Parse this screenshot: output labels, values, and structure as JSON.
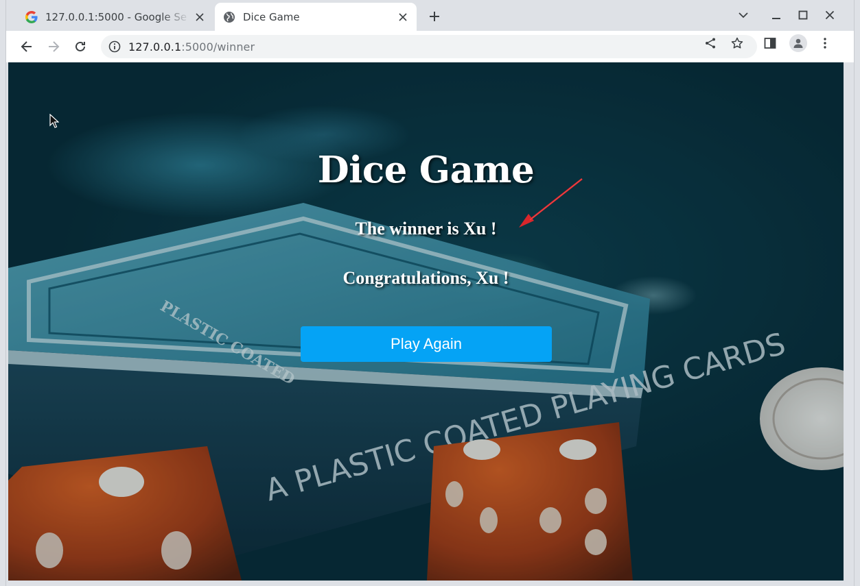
{
  "browser": {
    "tabs": [
      {
        "title": "127.0.0.1:5000 - Google Se",
        "favicon": "google-icon",
        "active": false
      },
      {
        "title": "Dice Game",
        "favicon": "globe-icon",
        "active": true
      }
    ],
    "address": {
      "host": "127.0.0.1",
      "path": ":5000/winner"
    }
  },
  "page": {
    "title": "Dice Game",
    "winner_text": "The winner is Xu !",
    "congrats_text": "Congratulations, Xu !",
    "play_again_label": "Play Again",
    "accent_color": "#05a3f5",
    "background_scene": "playing cards, dice and poker chips",
    "card_box_text": "A PLASTIC COATED PLAYING CARDS",
    "card_box_small_text": "PLASTIC COATED"
  }
}
